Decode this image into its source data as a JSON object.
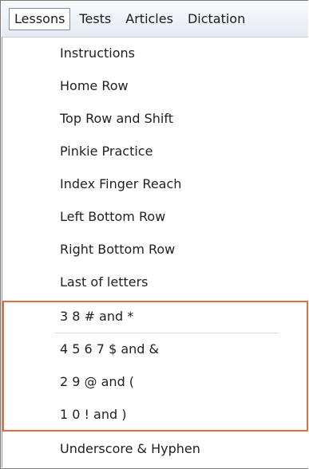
{
  "menubar": {
    "items": [
      "Lessons",
      "Tests",
      "Articles",
      "Dictation"
    ]
  },
  "lessons_menu": {
    "items": [
      "Instructions",
      "Home Row",
      "Top Row and Shift",
      "Pinkie Practice",
      "Index Finger Reach",
      "Left Bottom Row",
      "Right Bottom Row",
      "Last of letters",
      "3 8 # and *",
      "4 5 6 7 $ and &",
      "2 9 @ and (",
      "1 0 ! and )",
      "Underscore & Hyphen"
    ]
  },
  "colors": {
    "highlight_border": "#e2703e",
    "menubar_bg": "#e6ebf3"
  }
}
